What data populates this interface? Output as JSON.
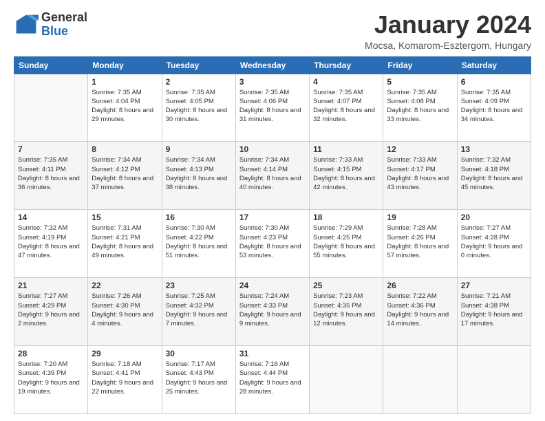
{
  "logo": {
    "general": "General",
    "blue": "Blue"
  },
  "header": {
    "month": "January 2024",
    "location": "Mocsa, Komarom-Esztergom, Hungary"
  },
  "weekdays": [
    "Sunday",
    "Monday",
    "Tuesday",
    "Wednesday",
    "Thursday",
    "Friday",
    "Saturday"
  ],
  "weeks": [
    [
      {
        "day": "",
        "sunrise": "",
        "sunset": "",
        "daylight": ""
      },
      {
        "day": "1",
        "sunrise": "Sunrise: 7:35 AM",
        "sunset": "Sunset: 4:04 PM",
        "daylight": "Daylight: 8 hours and 29 minutes."
      },
      {
        "day": "2",
        "sunrise": "Sunrise: 7:35 AM",
        "sunset": "Sunset: 4:05 PM",
        "daylight": "Daylight: 8 hours and 30 minutes."
      },
      {
        "day": "3",
        "sunrise": "Sunrise: 7:35 AM",
        "sunset": "Sunset: 4:06 PM",
        "daylight": "Daylight: 8 hours and 31 minutes."
      },
      {
        "day": "4",
        "sunrise": "Sunrise: 7:35 AM",
        "sunset": "Sunset: 4:07 PM",
        "daylight": "Daylight: 8 hours and 32 minutes."
      },
      {
        "day": "5",
        "sunrise": "Sunrise: 7:35 AM",
        "sunset": "Sunset: 4:08 PM",
        "daylight": "Daylight: 8 hours and 33 minutes."
      },
      {
        "day": "6",
        "sunrise": "Sunrise: 7:35 AM",
        "sunset": "Sunset: 4:09 PM",
        "daylight": "Daylight: 8 hours and 34 minutes."
      }
    ],
    [
      {
        "day": "7",
        "sunrise": "Sunrise: 7:35 AM",
        "sunset": "Sunset: 4:11 PM",
        "daylight": "Daylight: 8 hours and 36 minutes."
      },
      {
        "day": "8",
        "sunrise": "Sunrise: 7:34 AM",
        "sunset": "Sunset: 4:12 PM",
        "daylight": "Daylight: 8 hours and 37 minutes."
      },
      {
        "day": "9",
        "sunrise": "Sunrise: 7:34 AM",
        "sunset": "Sunset: 4:13 PM",
        "daylight": "Daylight: 8 hours and 38 minutes."
      },
      {
        "day": "10",
        "sunrise": "Sunrise: 7:34 AM",
        "sunset": "Sunset: 4:14 PM",
        "daylight": "Daylight: 8 hours and 40 minutes."
      },
      {
        "day": "11",
        "sunrise": "Sunrise: 7:33 AM",
        "sunset": "Sunset: 4:15 PM",
        "daylight": "Daylight: 8 hours and 42 minutes."
      },
      {
        "day": "12",
        "sunrise": "Sunrise: 7:33 AM",
        "sunset": "Sunset: 4:17 PM",
        "daylight": "Daylight: 8 hours and 43 minutes."
      },
      {
        "day": "13",
        "sunrise": "Sunrise: 7:32 AM",
        "sunset": "Sunset: 4:18 PM",
        "daylight": "Daylight: 8 hours and 45 minutes."
      }
    ],
    [
      {
        "day": "14",
        "sunrise": "Sunrise: 7:32 AM",
        "sunset": "Sunset: 4:19 PM",
        "daylight": "Daylight: 8 hours and 47 minutes."
      },
      {
        "day": "15",
        "sunrise": "Sunrise: 7:31 AM",
        "sunset": "Sunset: 4:21 PM",
        "daylight": "Daylight: 8 hours and 49 minutes."
      },
      {
        "day": "16",
        "sunrise": "Sunrise: 7:30 AM",
        "sunset": "Sunset: 4:22 PM",
        "daylight": "Daylight: 8 hours and 51 minutes."
      },
      {
        "day": "17",
        "sunrise": "Sunrise: 7:30 AM",
        "sunset": "Sunset: 4:23 PM",
        "daylight": "Daylight: 8 hours and 53 minutes."
      },
      {
        "day": "18",
        "sunrise": "Sunrise: 7:29 AM",
        "sunset": "Sunset: 4:25 PM",
        "daylight": "Daylight: 8 hours and 55 minutes."
      },
      {
        "day": "19",
        "sunrise": "Sunrise: 7:28 AM",
        "sunset": "Sunset: 4:26 PM",
        "daylight": "Daylight: 8 hours and 57 minutes."
      },
      {
        "day": "20",
        "sunrise": "Sunrise: 7:27 AM",
        "sunset": "Sunset: 4:28 PM",
        "daylight": "Daylight: 9 hours and 0 minutes."
      }
    ],
    [
      {
        "day": "21",
        "sunrise": "Sunrise: 7:27 AM",
        "sunset": "Sunset: 4:29 PM",
        "daylight": "Daylight: 9 hours and 2 minutes."
      },
      {
        "day": "22",
        "sunrise": "Sunrise: 7:26 AM",
        "sunset": "Sunset: 4:30 PM",
        "daylight": "Daylight: 9 hours and 4 minutes."
      },
      {
        "day": "23",
        "sunrise": "Sunrise: 7:25 AM",
        "sunset": "Sunset: 4:32 PM",
        "daylight": "Daylight: 9 hours and 7 minutes."
      },
      {
        "day": "24",
        "sunrise": "Sunrise: 7:24 AM",
        "sunset": "Sunset: 4:33 PM",
        "daylight": "Daylight: 9 hours and 9 minutes."
      },
      {
        "day": "25",
        "sunrise": "Sunrise: 7:23 AM",
        "sunset": "Sunset: 4:35 PM",
        "daylight": "Daylight: 9 hours and 12 minutes."
      },
      {
        "day": "26",
        "sunrise": "Sunrise: 7:22 AM",
        "sunset": "Sunset: 4:36 PM",
        "daylight": "Daylight: 9 hours and 14 minutes."
      },
      {
        "day": "27",
        "sunrise": "Sunrise: 7:21 AM",
        "sunset": "Sunset: 4:38 PM",
        "daylight": "Daylight: 9 hours and 17 minutes."
      }
    ],
    [
      {
        "day": "28",
        "sunrise": "Sunrise: 7:20 AM",
        "sunset": "Sunset: 4:39 PM",
        "daylight": "Daylight: 9 hours and 19 minutes."
      },
      {
        "day": "29",
        "sunrise": "Sunrise: 7:18 AM",
        "sunset": "Sunset: 4:41 PM",
        "daylight": "Daylight: 9 hours and 22 minutes."
      },
      {
        "day": "30",
        "sunrise": "Sunrise: 7:17 AM",
        "sunset": "Sunset: 4:43 PM",
        "daylight": "Daylight: 9 hours and 25 minutes."
      },
      {
        "day": "31",
        "sunrise": "Sunrise: 7:16 AM",
        "sunset": "Sunset: 4:44 PM",
        "daylight": "Daylight: 9 hours and 28 minutes."
      },
      {
        "day": "",
        "sunrise": "",
        "sunset": "",
        "daylight": ""
      },
      {
        "day": "",
        "sunrise": "",
        "sunset": "",
        "daylight": ""
      },
      {
        "day": "",
        "sunrise": "",
        "sunset": "",
        "daylight": ""
      }
    ]
  ]
}
